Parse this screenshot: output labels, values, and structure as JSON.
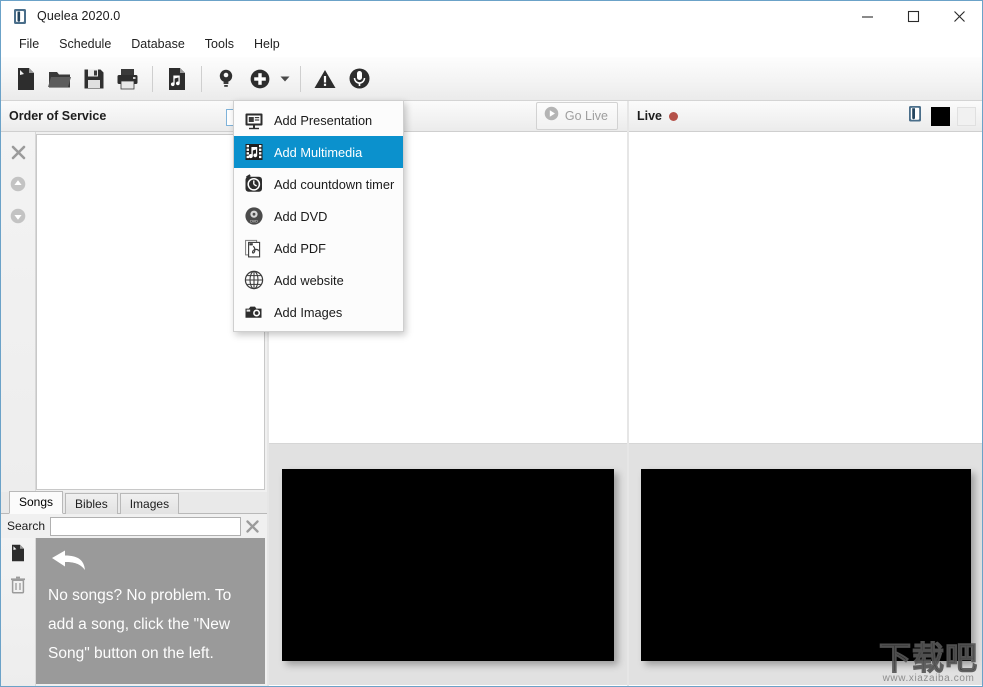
{
  "window": {
    "title": "Quelea 2020.0",
    "app_icon": "quelea-logo-icon",
    "controls": {
      "minimize": "—",
      "maximize": "☐",
      "close": "✕"
    }
  },
  "menubar": {
    "items": [
      {
        "label": "File"
      },
      {
        "label": "Schedule"
      },
      {
        "label": "Database"
      },
      {
        "label": "Tools"
      },
      {
        "label": "Help"
      }
    ]
  },
  "toolbar": {
    "buttons": [
      {
        "name": "new-schedule-icon",
        "tooltip": "New schedule"
      },
      {
        "name": "open-schedule-icon",
        "tooltip": "Open schedule"
      },
      {
        "name": "save-schedule-icon",
        "tooltip": "Save schedule"
      },
      {
        "name": "print-schedule-icon",
        "tooltip": "Print schedule"
      },
      {
        "name": "add-song-icon",
        "tooltip": "Add song"
      },
      {
        "name": "quick-insert-icon",
        "tooltip": "Quick insert"
      },
      {
        "name": "add-item-icon",
        "tooltip": "Add item"
      },
      {
        "name": "add-item-caret-icon",
        "tooltip": "Add item menu"
      },
      {
        "name": "notice-icon",
        "tooltip": "Notices"
      },
      {
        "name": "record-icon",
        "tooltip": "Record audio"
      }
    ]
  },
  "dropdown": {
    "open": true,
    "highlight_color": "#0b91cd",
    "items": [
      {
        "label": "Add Presentation",
        "icon": "presentation-icon",
        "selected": false
      },
      {
        "label": "Add Multimedia",
        "icon": "multimedia-film-icon",
        "selected": true
      },
      {
        "label": "Add countdown timer",
        "icon": "alarm-clock-icon",
        "selected": false
      },
      {
        "label": "Add DVD",
        "icon": "dvd-disc-icon",
        "selected": false
      },
      {
        "label": "Add PDF",
        "icon": "pdf-file-icon",
        "selected": false
      },
      {
        "label": "Add website",
        "icon": "globe-icon",
        "selected": false
      },
      {
        "label": "Add Images",
        "icon": "camera-icon",
        "selected": false
      }
    ]
  },
  "order_of_service": {
    "title": "Order of Service",
    "side_tools": [
      {
        "name": "remove-item-icon",
        "glyph": "✕"
      },
      {
        "name": "move-up-icon",
        "glyph": "▲"
      },
      {
        "name": "move-down-icon",
        "glyph": "▼"
      }
    ],
    "items": []
  },
  "library": {
    "tabs": [
      {
        "label": "Songs",
        "active": true
      },
      {
        "label": "Bibles",
        "active": false
      },
      {
        "label": "Images",
        "active": false
      }
    ],
    "search": {
      "label": "Search",
      "value": "",
      "placeholder": "",
      "clear_icon": "clear-search-icon"
    },
    "side_tools": [
      {
        "name": "new-song-icon"
      },
      {
        "name": "delete-song-icon"
      }
    ],
    "empty_state": {
      "arrow_icon": "curved-arrow-left-icon",
      "text": "No songs? No problem. To add a song, click the \"New Song\" button on the left."
    }
  },
  "preview_panel": {
    "go_live": {
      "label": "Go Live",
      "icon": "play-circle-icon",
      "enabled": false
    },
    "screen": {
      "name": "preview-black-screen",
      "color": "#000000"
    }
  },
  "live_panel": {
    "title": "Live",
    "status_dot_color": "#b5524a",
    "header_icons": [
      {
        "name": "logo-display-icon"
      },
      {
        "name": "black-screen-toggle-icon",
        "color": "#000000"
      },
      {
        "name": "clear-screen-toggle-icon",
        "color": "#f1f1f1"
      }
    ],
    "screen": {
      "name": "live-black-screen",
      "color": "#000000"
    }
  },
  "watermark": {
    "text": "下载吧",
    "url": "www.xiazaiba.com"
  }
}
